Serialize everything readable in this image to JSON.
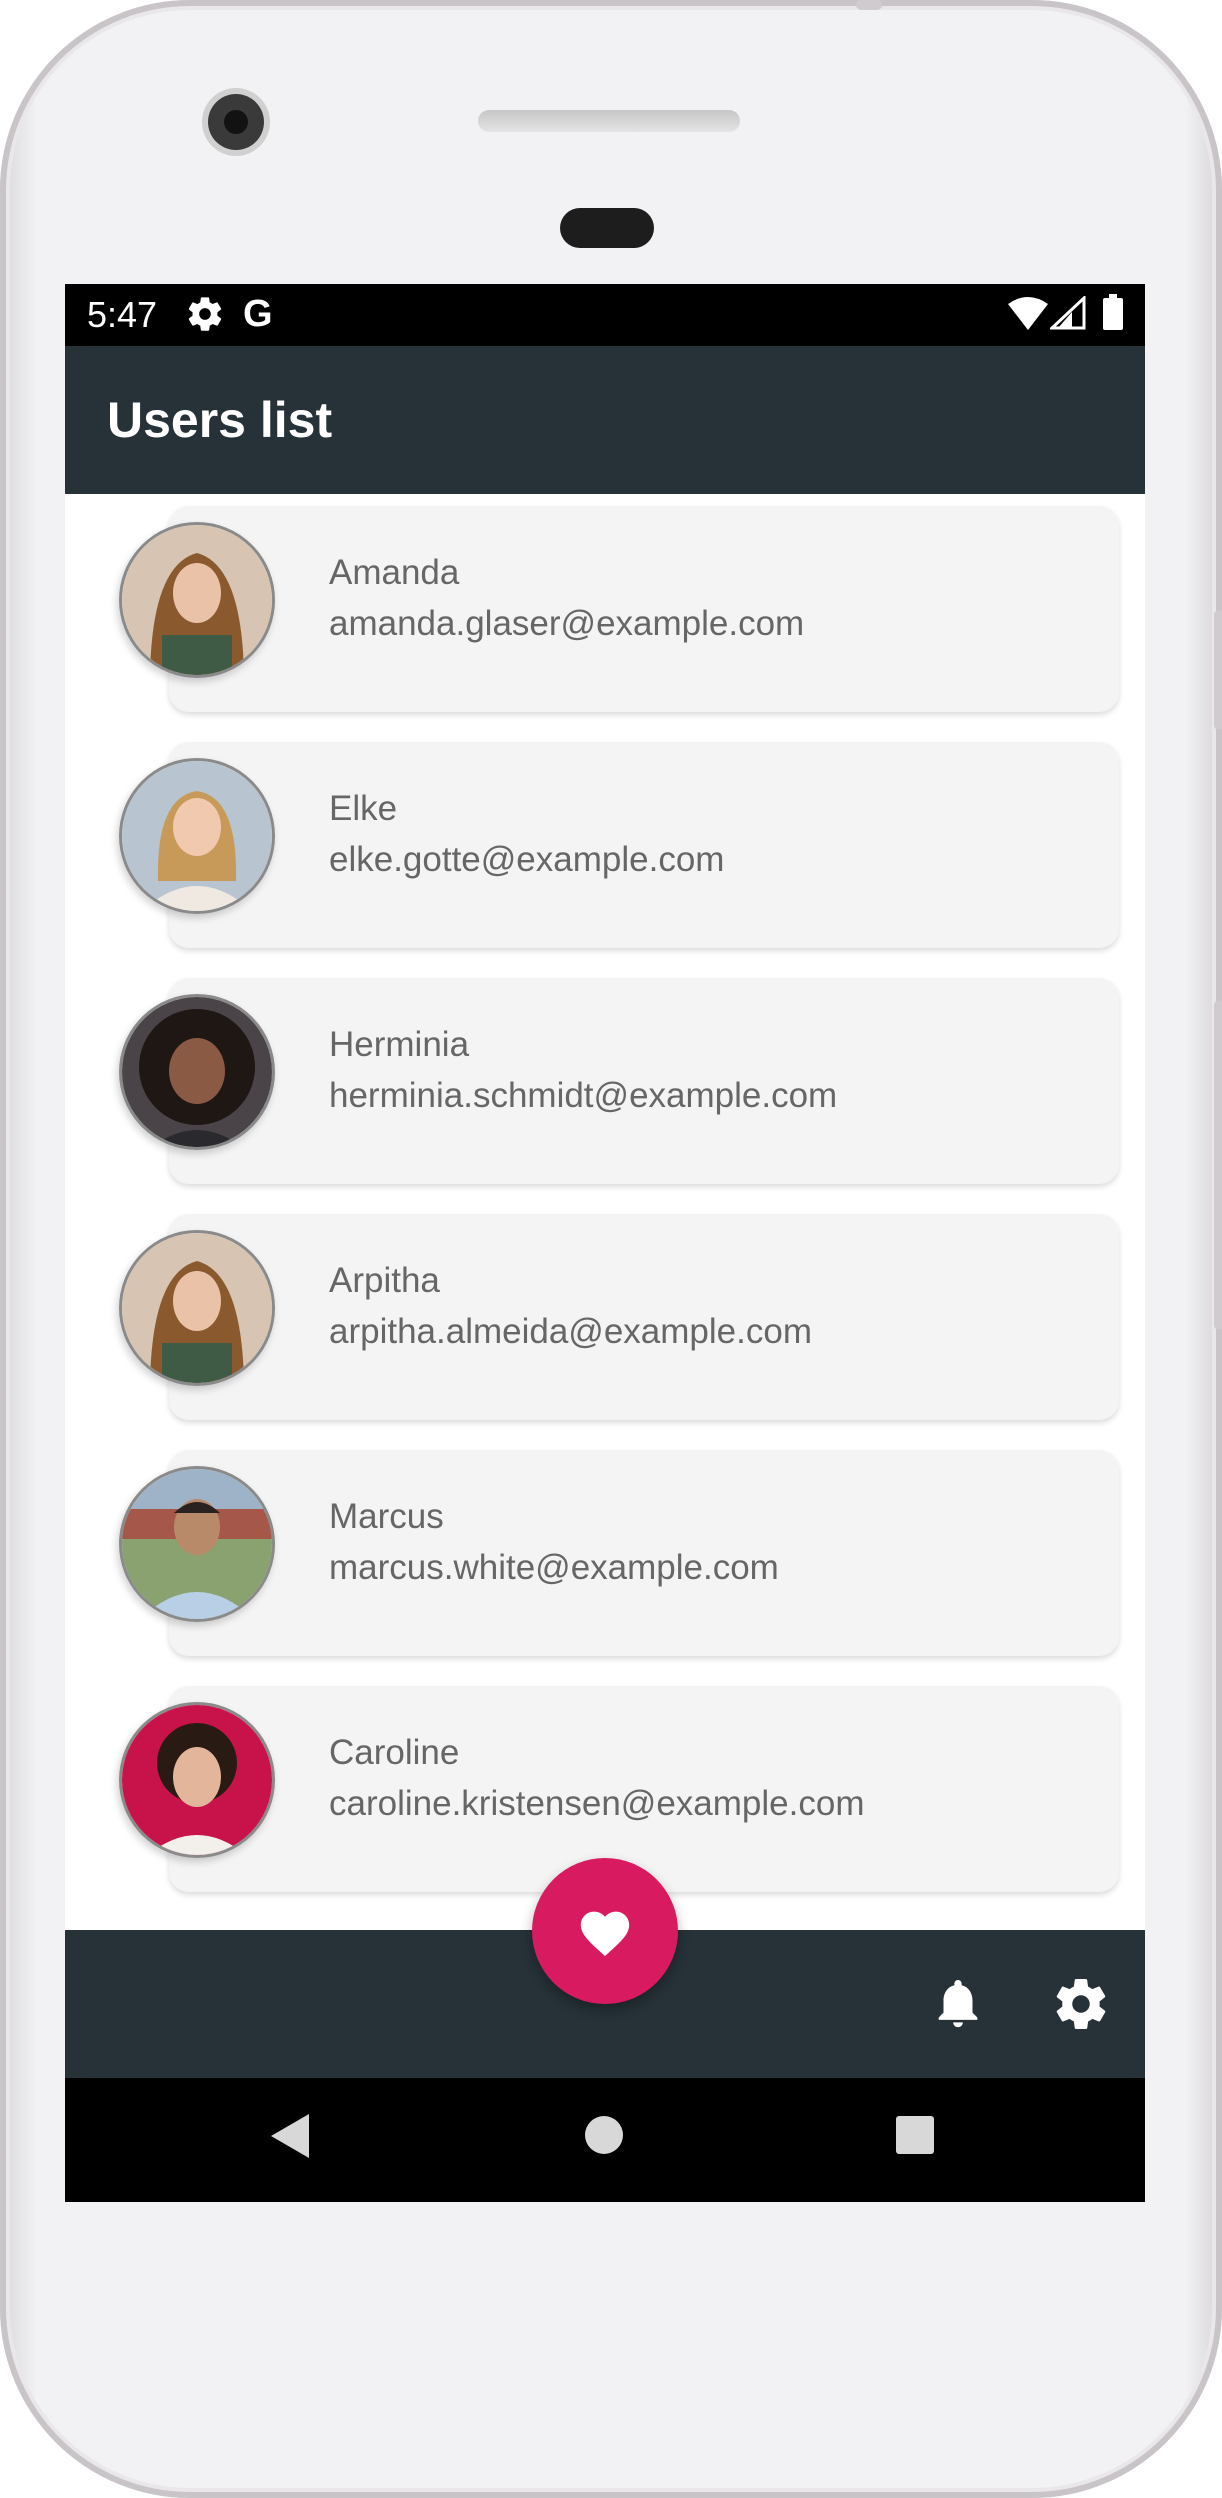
{
  "status_bar": {
    "time": "5:47",
    "icons": [
      "gear-icon",
      "google-g-icon",
      "wifi-icon",
      "signal-icon",
      "battery-icon"
    ],
    "google_letter": "G"
  },
  "app_bar": {
    "title": "Users list"
  },
  "users": [
    {
      "name": "Amanda",
      "email": "amanda.glaser@example.com",
      "avatar_bg": "#c9b7a6",
      "hair": "#8a5a2e",
      "skin": "#e9c2a8",
      "shirt": "#3f5a45"
    },
    {
      "name": "Elke",
      "email": "elke.gotte@example.com",
      "avatar_bg": "#b8c4cf",
      "hair": "#c89a5a",
      "skin": "#f0c9ae",
      "shirt": "#efe9e2"
    },
    {
      "name": "Herminia",
      "email": "herminia.schmidt@example.com",
      "avatar_bg": "#4a4448",
      "hair": "#1f1714",
      "skin": "#8a5a45",
      "shirt": "#2a2a2e"
    },
    {
      "name": "Arpitha",
      "email": "arpitha.almeida@example.com",
      "avatar_bg": "#c9b7a6",
      "hair": "#8a5a2e",
      "skin": "#e9c2a8",
      "shirt": "#3f5a45"
    },
    {
      "name": "Marcus",
      "email": "marcus.white@example.com",
      "avatar_bg": "#8aa270",
      "hair": "#2a2220",
      "skin": "#b98a6a",
      "shirt": "#b9cfe6"
    },
    {
      "name": "Caroline",
      "email": "caroline.kristensen@example.com",
      "avatar_bg": "#c8134a",
      "hair": "#2a1a14",
      "skin": "#e3b59a",
      "shirt": "#f3f0ec"
    }
  ],
  "fab": {
    "icon": "heart-icon",
    "color": "#d81b60"
  },
  "bottom_bar": {
    "icons": [
      "bell-icon",
      "settings-gear-icon"
    ]
  },
  "nav_bar": {
    "icons": [
      "back-triangle-icon",
      "home-circle-icon",
      "recents-square-icon"
    ]
  },
  "colors": {
    "app_bar": "#263238",
    "card": "#f4f4f5",
    "text": "#666666",
    "accent": "#d81b60"
  }
}
